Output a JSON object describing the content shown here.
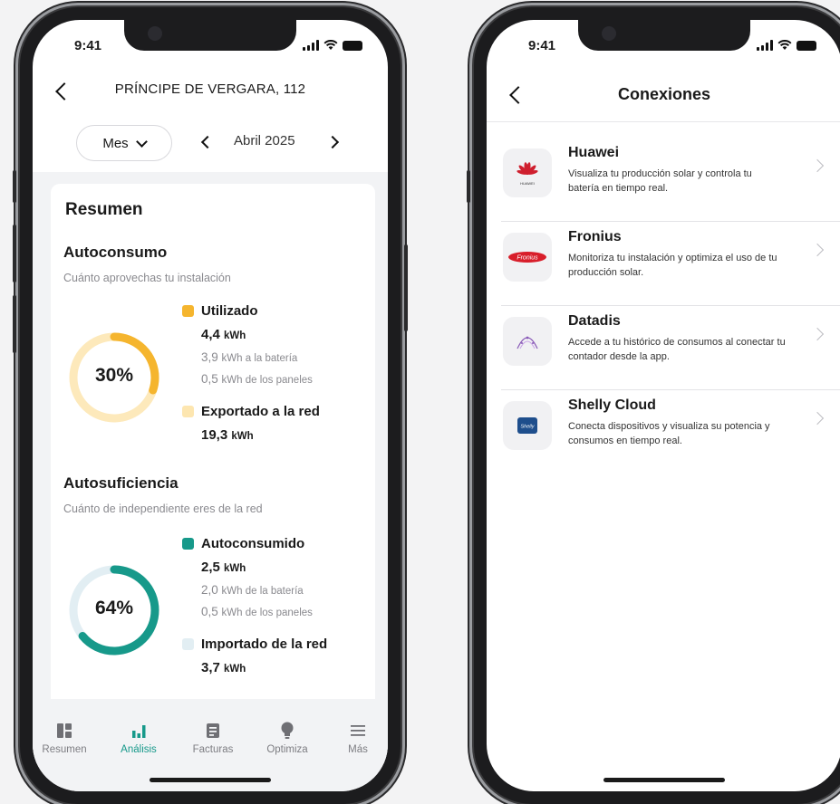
{
  "left_screen": {
    "status_time": "9:41",
    "address": "PRÍNCIPE DE VERGARA, 112",
    "period_selector": "Mes",
    "month_label": "Abril 2025",
    "summary": {
      "title": "Resumen",
      "autoconsumo": {
        "title": "Autoconsumo",
        "subtitle": "Cuánto aprovechas tu instalación",
        "percent_label": "30%",
        "percent_value": 0.3,
        "ring_color": "#f5b52e",
        "ring_track_color": "#fde9bb",
        "used_label": "Utilizado",
        "used_value": "4,4",
        "used_unit": "kWh",
        "battery_value": "3,9",
        "battery_text": "kWh a la batería",
        "panels_value": "0,5",
        "panels_text": "kWh de los paneles",
        "exported_label": "Exportado a la red",
        "exported_value": "19,3",
        "exported_unit": "kWh"
      },
      "autosuficiencia": {
        "title": "Autosuficiencia",
        "subtitle": "Cuánto de independiente eres de la red",
        "percent_label": "64%",
        "percent_value": 0.64,
        "ring_color": "#17998a",
        "ring_track_color": "#e2eef3",
        "self_label": "Autoconsumido",
        "self_value": "2,5",
        "self_unit": "kWh",
        "battery_value": "2,0",
        "battery_text": "kWh de la batería",
        "panels_value": "0,5",
        "panels_text": "kWh de los paneles",
        "imported_label": "Importado de la red",
        "imported_value": "3,7",
        "imported_unit": "kWh"
      }
    },
    "tabs": [
      {
        "label": "Resumen",
        "icon": "dashboard-icon"
      },
      {
        "label": "Análisis",
        "icon": "bar-chart-icon"
      },
      {
        "label": "Facturas",
        "icon": "invoice-icon"
      },
      {
        "label": "Optimiza",
        "icon": "lightbulb-icon"
      },
      {
        "label": "Más",
        "icon": "menu-icon"
      }
    ],
    "active_tab": "Análisis"
  },
  "right_screen": {
    "status_time": "9:41",
    "title": "Conexiones",
    "connections": [
      {
        "name": "Huawei",
        "description": "Visualiza tu producción solar y controla tu batería en tiempo real.",
        "logo_text": "HUAWEI"
      },
      {
        "name": "Fronius",
        "description": "Monitoriza tu instalación y optimiza el uso de tu producción solar.",
        "logo_text": "Fronius"
      },
      {
        "name": "Datadis",
        "description": "Accede a tu histórico de consumos al conectar tu contador desde la app.",
        "logo_text": ""
      },
      {
        "name": "Shelly Cloud",
        "description": "Conecta dispositivos y visualiza su potencia y consumos en tiempo real.",
        "logo_text": "Shelly"
      }
    ]
  },
  "colors": {
    "accent": "#17998a",
    "solar_yellow": "#f5b52e",
    "huawei_red": "#cf1f2e",
    "fronius_red": "#d81e2a",
    "datadis_purple": "#8a5bb8",
    "shelly_blue": "#1e4e8c"
  }
}
